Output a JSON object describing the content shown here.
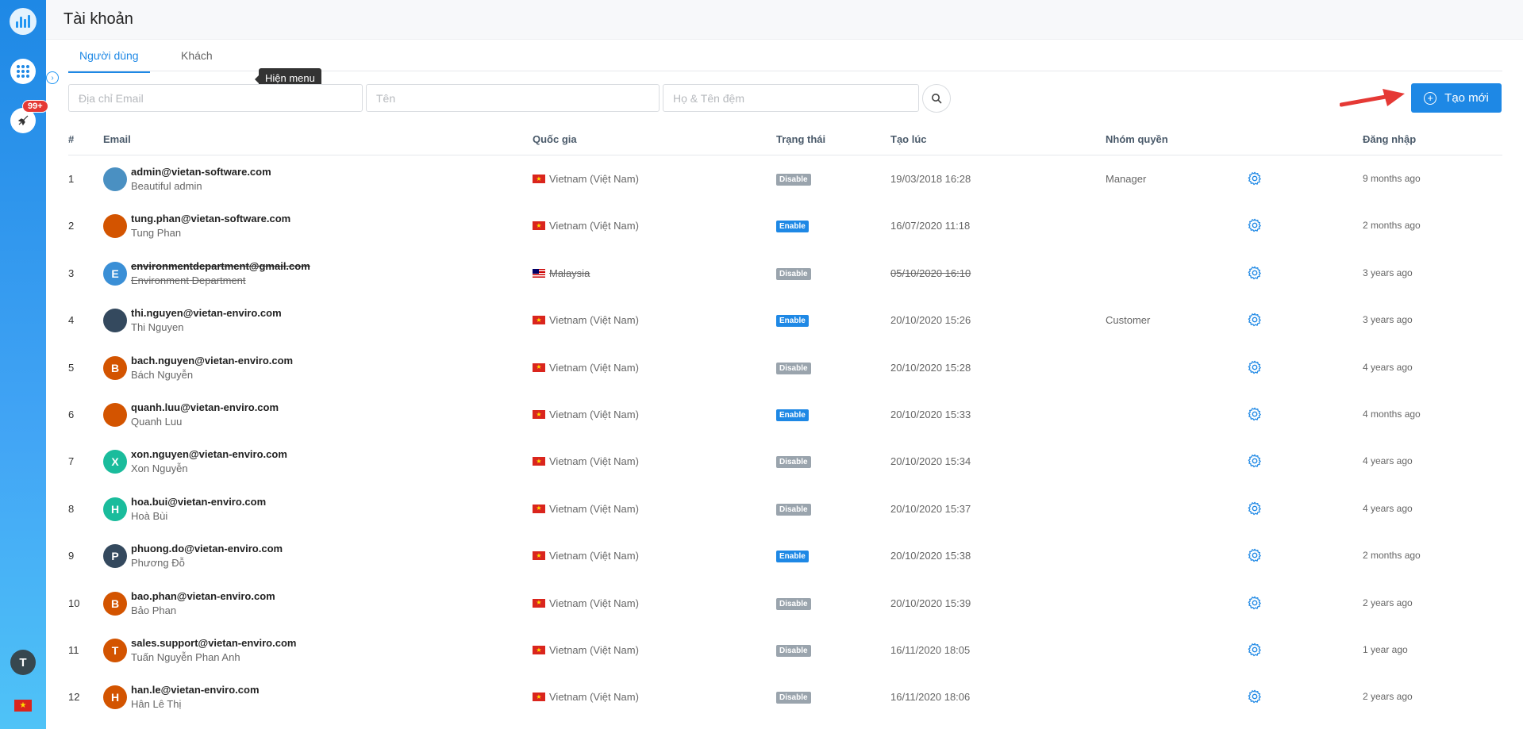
{
  "header": {
    "title": "Tài khoản"
  },
  "tabs": [
    {
      "label": "Người dùng"
    },
    {
      "label": "Khách"
    }
  ],
  "tooltip": "Hiện menu",
  "sidebar": {
    "badge": "99+",
    "user_initial": "T"
  },
  "filters": {
    "email_placeholder": "Địa chỉ Email",
    "first_name_placeholder": "Tên",
    "last_name_placeholder": "Họ & Tên đệm"
  },
  "create_button": "Tạo mới",
  "table": {
    "columns": [
      "#",
      "Email",
      "Quốc gia",
      "Trạng thái",
      "Tạo lúc",
      "Nhóm quyền",
      "Đăng nhập"
    ],
    "rows": [
      {
        "num": "1",
        "email": "admin@vietan-software.com",
        "name": "Beautiful admin",
        "country": "Vietnam (Việt Nam)",
        "status": "Disable",
        "created": "19/03/2018 16:28",
        "group": "Manager",
        "login": "9 months ago",
        "initial": "",
        "avatar_color": "#4a90c2",
        "deleted": false
      },
      {
        "num": "2",
        "email": "tung.phan@vietan-software.com",
        "name": "Tung Phan",
        "country": "Vietnam (Việt Nam)",
        "status": "Enable",
        "created": "16/07/2020 11:18",
        "group": "",
        "login": "2 months ago",
        "initial": "",
        "avatar_color": "#d35400",
        "deleted": false
      },
      {
        "num": "3",
        "email": "environmentdepartment@gmail.com",
        "name": "Environment Department",
        "country": "Malaysia",
        "status": "Disable",
        "created": "05/10/2020 16:10",
        "group": "",
        "login": "3 years ago",
        "initial": "E",
        "avatar_color": "#3a8fd6",
        "deleted": true
      },
      {
        "num": "4",
        "email": "thi.nguyen@vietan-enviro.com",
        "name": "Thi Nguyen",
        "country": "Vietnam (Việt Nam)",
        "status": "Enable",
        "created": "20/10/2020 15:26",
        "group": "Customer",
        "login": "3 years ago",
        "initial": "",
        "avatar_color": "#34495e",
        "deleted": false
      },
      {
        "num": "5",
        "email": "bach.nguyen@vietan-enviro.com",
        "name": "Bách Nguyễn",
        "country": "Vietnam (Việt Nam)",
        "status": "Disable",
        "created": "20/10/2020 15:28",
        "group": "",
        "login": "4 years ago",
        "initial": "B",
        "avatar_color": "#d35400",
        "deleted": false
      },
      {
        "num": "6",
        "email": "quanh.luu@vietan-enviro.com",
        "name": "Quanh Luu",
        "country": "Vietnam (Việt Nam)",
        "status": "Enable",
        "created": "20/10/2020 15:33",
        "group": "",
        "login": "4 months ago",
        "initial": "",
        "avatar_color": "#d35400",
        "deleted": false
      },
      {
        "num": "7",
        "email": "xon.nguyen@vietan-enviro.com",
        "name": "Xon Nguyễn",
        "country": "Vietnam (Việt Nam)",
        "status": "Disable",
        "created": "20/10/2020 15:34",
        "group": "",
        "login": "4 years ago",
        "initial": "X",
        "avatar_color": "#1abc9c",
        "deleted": false
      },
      {
        "num": "8",
        "email": "hoa.bui@vietan-enviro.com",
        "name": "Hoà Bùi",
        "country": "Vietnam (Việt Nam)",
        "status": "Disable",
        "created": "20/10/2020 15:37",
        "group": "",
        "login": "4 years ago",
        "initial": "H",
        "avatar_color": "#1abc9c",
        "deleted": false
      },
      {
        "num": "9",
        "email": "phuong.do@vietan-enviro.com",
        "name": "Phương Đỗ",
        "country": "Vietnam (Việt Nam)",
        "status": "Enable",
        "created": "20/10/2020 15:38",
        "group": "",
        "login": "2 months ago",
        "initial": "P",
        "avatar_color": "#34495e",
        "deleted": false
      },
      {
        "num": "10",
        "email": "bao.phan@vietan-enviro.com",
        "name": "Bảo Phan",
        "country": "Vietnam (Việt Nam)",
        "status": "Disable",
        "created": "20/10/2020 15:39",
        "group": "",
        "login": "2 years ago",
        "initial": "B",
        "avatar_color": "#d35400",
        "deleted": false
      },
      {
        "num": "11",
        "email": "sales.support@vietan-enviro.com",
        "name": "Tuấn Nguyễn Phan Anh",
        "country": "Vietnam (Việt Nam)",
        "status": "Disable",
        "created": "16/11/2020 18:05",
        "group": "",
        "login": "1 year ago",
        "initial": "T",
        "avatar_color": "#d35400",
        "deleted": false
      },
      {
        "num": "12",
        "email": "han.le@vietan-enviro.com",
        "name": "Hân Lê Thị",
        "country": "Vietnam (Việt Nam)",
        "status": "Disable",
        "created": "16/11/2020 18:06",
        "group": "",
        "login": "2 years ago",
        "initial": "H",
        "avatar_color": "#d35400",
        "deleted": false
      }
    ]
  },
  "colors": {
    "primary": "#1e88e5",
    "enable": "#1e88e5",
    "disable": "#9aa4ad",
    "arrow": "#e53935"
  },
  "icons": {
    "search": "search-icon",
    "gear": "gear-icon",
    "plus": "plus-circle-icon",
    "apps": "apps-grid-icon",
    "rocket": "rocket-icon"
  }
}
